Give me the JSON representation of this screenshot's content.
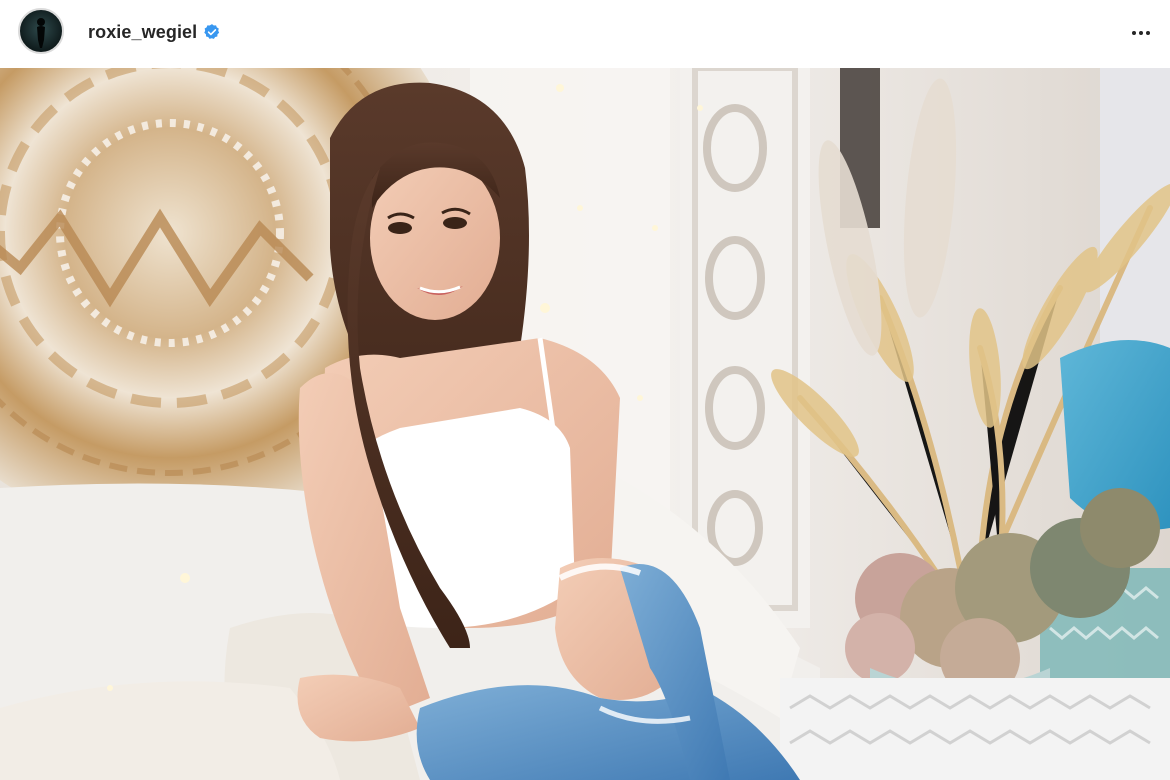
{
  "post": {
    "username": "roxie_wegiel",
    "verified": true,
    "avatar_icon": "profile-avatar",
    "verified_icon": "verified-badge-icon",
    "more_icon": "more-options-icon",
    "image_description_icon": "photo"
  },
  "colors": {
    "verified_blue": "#3897f0",
    "username_text": "#262626"
  }
}
